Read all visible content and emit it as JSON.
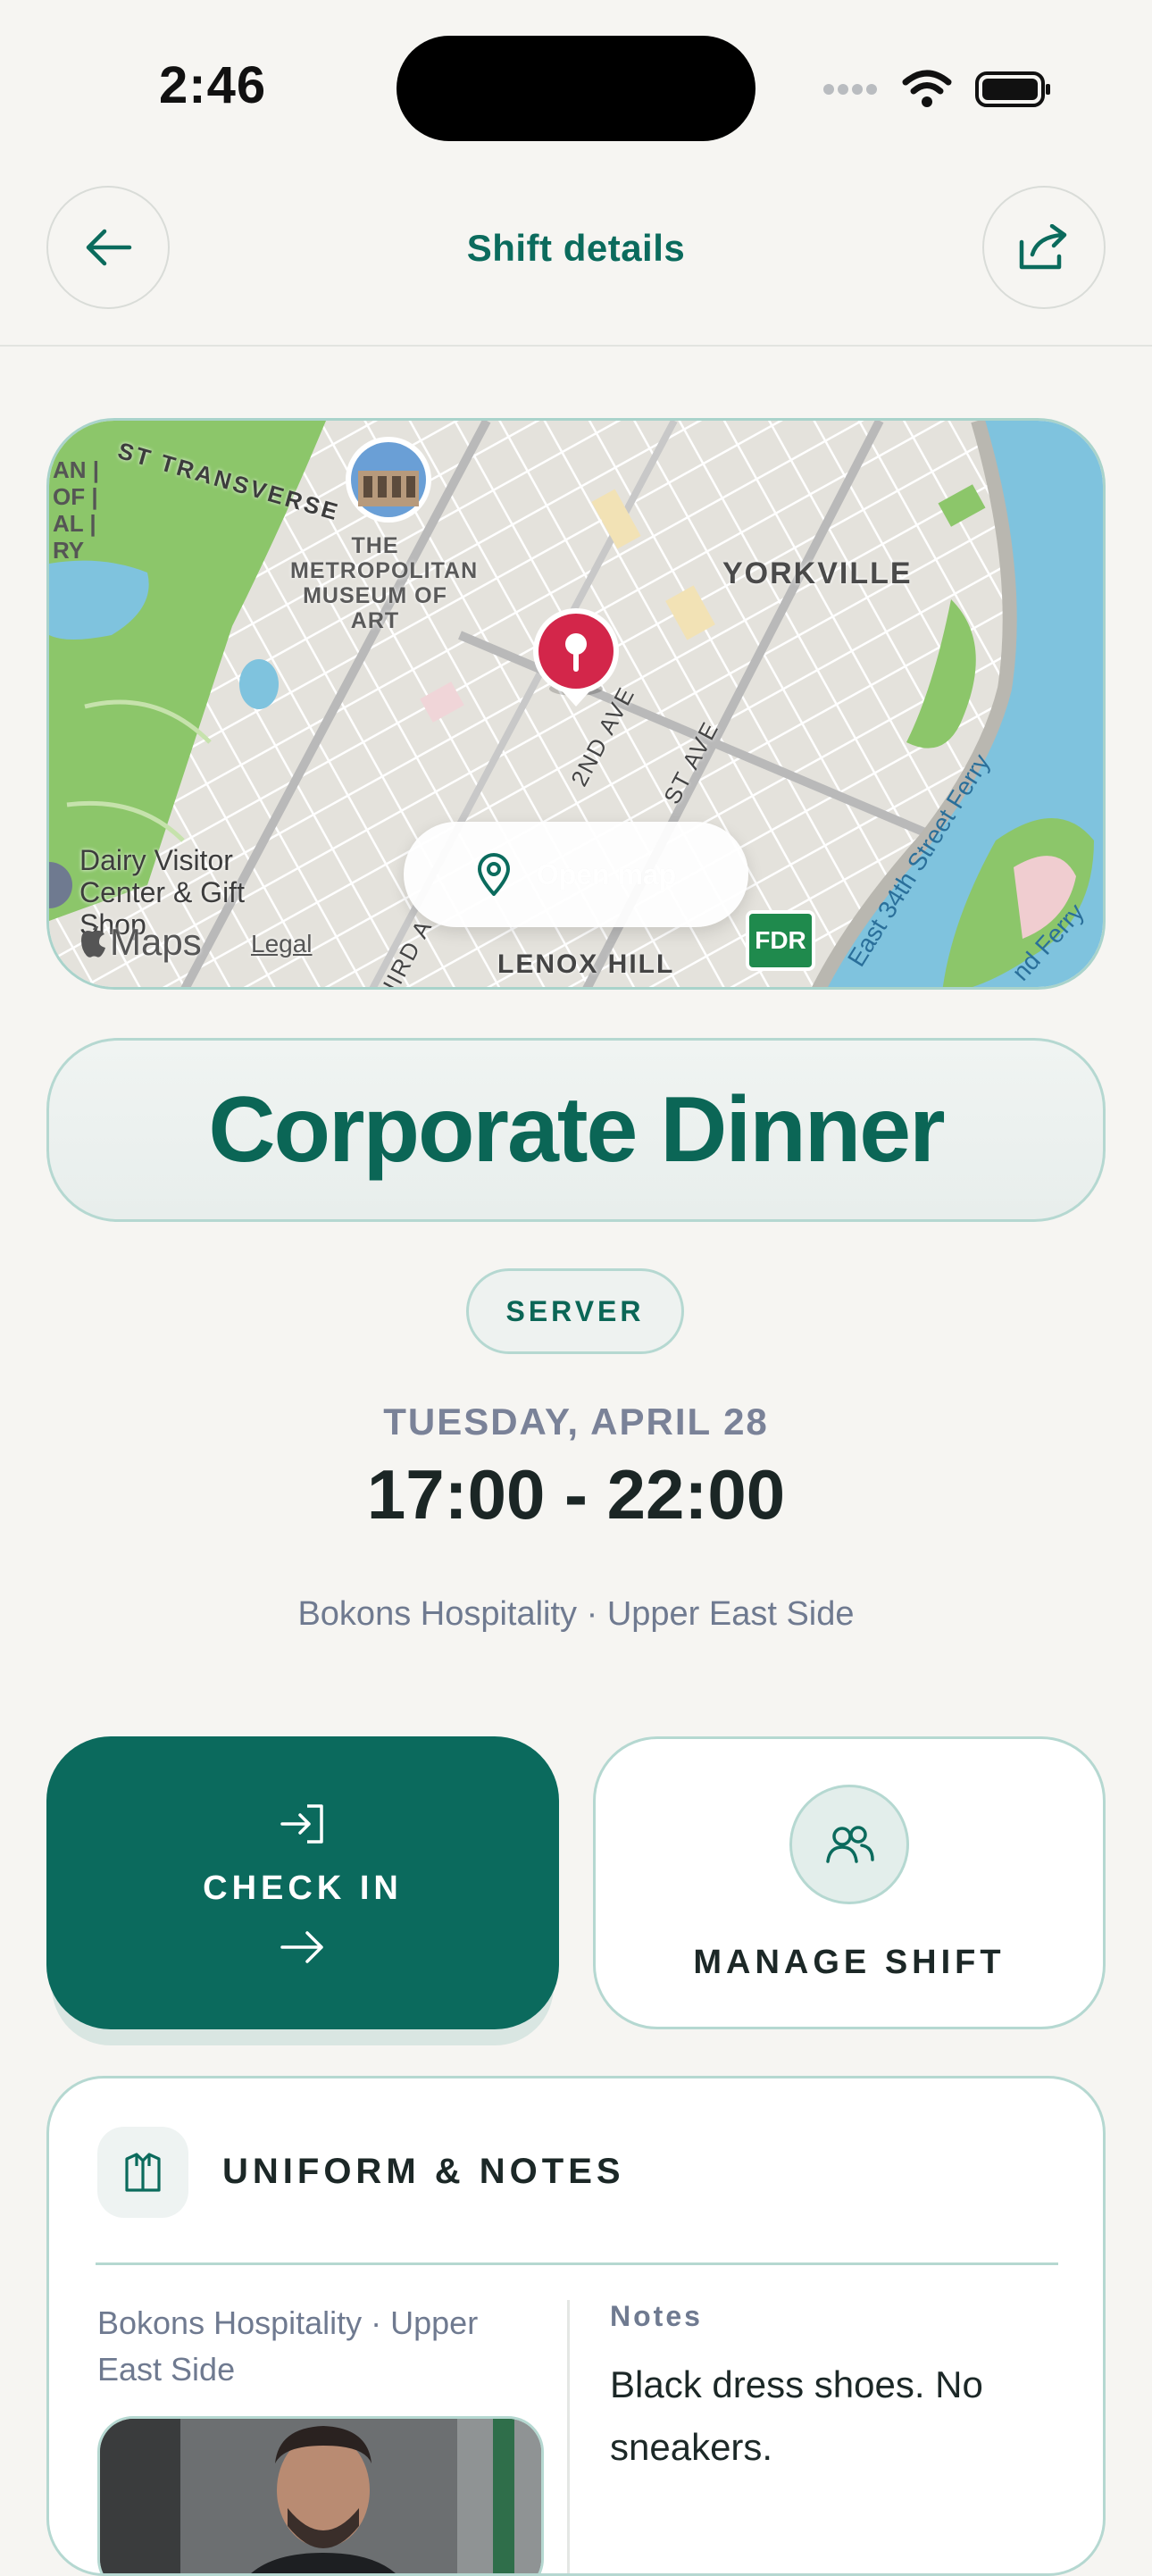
{
  "status_bar": {
    "time": "2:46"
  },
  "header": {
    "title": "Shift details"
  },
  "map": {
    "labels": {
      "transverse": "ST TRANSVERSE",
      "met": "THE METROPOLITAN MUSEUM OF ART",
      "yorkville": "YORKVILLE",
      "second_ave": "2ND AVE",
      "first_ave": "ST AVE",
      "third_ave": "HIRD A",
      "dairy": "Dairy Visitor Center & Gift Shop",
      "lenox": "LENOX HILL",
      "fdr": "FDR",
      "ferry1": "East 34th Street Ferry",
      "ferry2": "nd Ferry",
      "edge_left": "AN | OF | AL | RY",
      "maps_brand": "Maps",
      "legal": "Legal"
    },
    "open_map_label": "Open map"
  },
  "shift": {
    "title": "Corporate Dinner",
    "role": "SERVER",
    "date": "TUESDAY, APRIL 28",
    "hours": "17:00 - 22:00",
    "venue": "Bokons Hospitality · Upper East Side"
  },
  "actions": {
    "check_in_label": "CHECK IN",
    "manage_label": "MANAGE SHIFT"
  },
  "uniform": {
    "title": "UNIFORM & NOTES",
    "venue": "Bokons Hospitality · Upper East Side",
    "notes_heading": "Notes",
    "notes_text": "Black dress shoes. No sneakers."
  },
  "colors": {
    "brand": "#0b6a5d",
    "pin": "#d3264a",
    "water": "#7fc3de",
    "park": "#8cc66a"
  },
  "icons": [
    "back-arrow-icon",
    "share-icon",
    "location-pin-icon",
    "check-in-icon",
    "arrow-right-icon",
    "people-icon",
    "shirt-icon",
    "wifi-icon",
    "battery-icon"
  ]
}
